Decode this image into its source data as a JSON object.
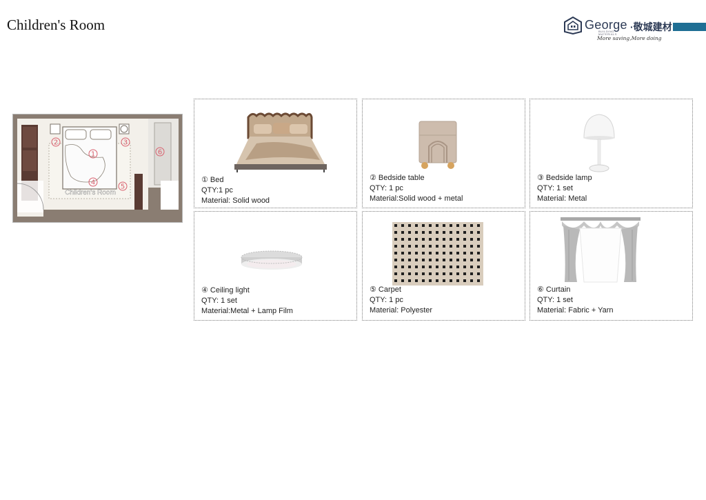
{
  "page": {
    "title": "Children's Room"
  },
  "logo": {
    "brand": "George",
    "brand_cn": "·敬城建材",
    "subtitle": "BUILDING MATERIALS",
    "slogan": "More saving,More doing",
    "bar_color": "#1f6f94"
  },
  "floorplan": {
    "room_label": "Children's Room",
    "markers": [
      "①",
      "②",
      "③",
      "④",
      "⑤",
      "⑥"
    ],
    "marker_color": "#d9606e"
  },
  "items": [
    {
      "name": "① Bed",
      "qty": "QTY:1 pc",
      "material": "Material: Solid wood"
    },
    {
      "name": "② Bedside table",
      "qty": "QTY: 1 pc",
      "material": "Material:Solid wood + metal"
    },
    {
      "name": "③ Bedside lamp",
      "qty": "QTY: 1 set",
      "material": "Material: Metal"
    },
    {
      "name": "④ Ceiling light",
      "qty": "QTY: 1 set",
      "material": "Material:Metal + Lamp Film"
    },
    {
      "name": "⑤ Carpet",
      "qty": "QTY: 1 pc",
      "material": "Material: Polyester"
    },
    {
      "name": "⑥ Curtain",
      "qty": "QTY: 1 set",
      "material": "Material: Fabric + Yarn"
    }
  ]
}
